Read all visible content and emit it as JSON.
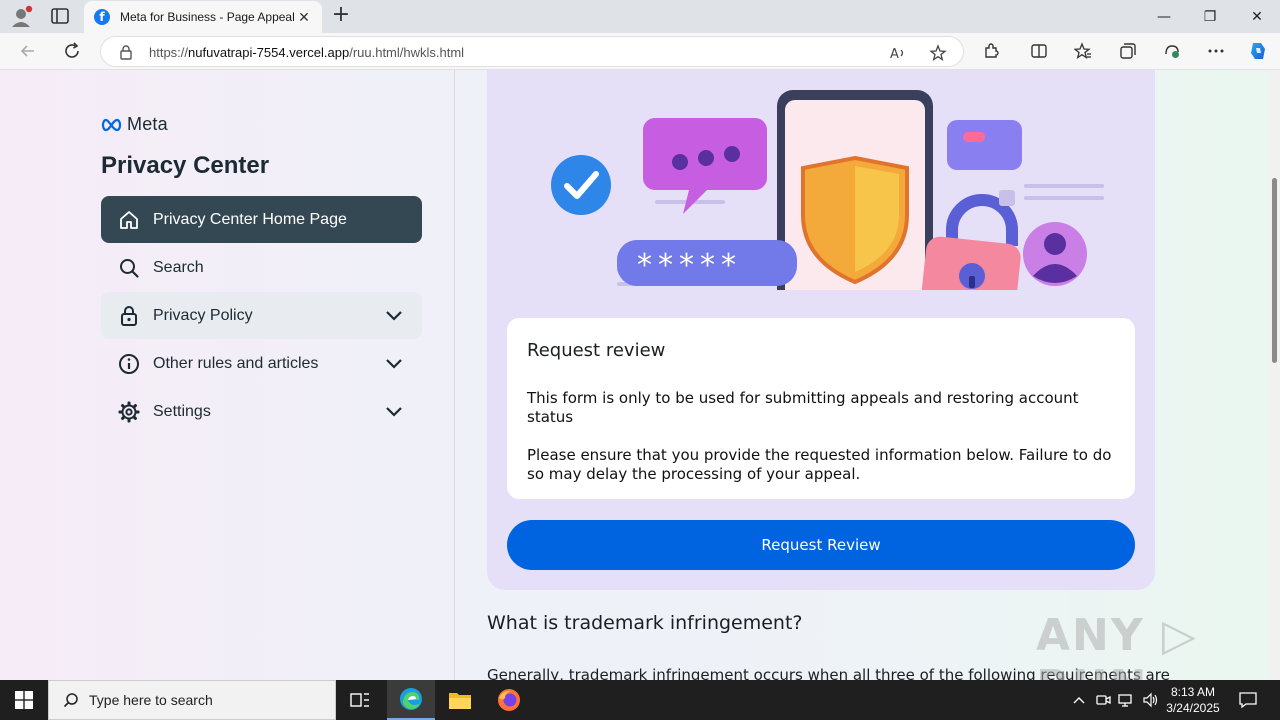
{
  "browser": {
    "tab_title": "Meta for Business - Page Appeal",
    "tab_close": "✕",
    "new_tab": "+",
    "url_prefix": "https://",
    "url_host": "nufuvatrapi-7554.vercel.app",
    "url_path": "/ruu.html/hwkls.html",
    "window_min": "—",
    "window_max": "❐",
    "window_close": "✕"
  },
  "sidebar": {
    "logo_text": "Meta",
    "title": "Privacy Center",
    "items": [
      {
        "label": "Privacy Center Home Page",
        "icon": "home-icon"
      },
      {
        "label": "Search",
        "icon": "search-icon"
      },
      {
        "label": "Privacy Policy",
        "icon": "lock-icon"
      },
      {
        "label": "Other rules and articles",
        "icon": "info-icon"
      },
      {
        "label": "Settings",
        "icon": "gear-icon"
      }
    ]
  },
  "main": {
    "card_title": "Request review",
    "card_text_1": "This form is only to be used for submitting appeals and restoring account status",
    "card_text_2": "Please ensure that you provide the requested information below. Failure to do so may delay the processing of your appeal.",
    "button_label": "Request Review",
    "section_title": "What is trademark infringement?",
    "section_text": "Generally, trademark infringement occurs when all three of the following requirements are"
  },
  "watermark": "ANY ▷ RUN",
  "taskbar": {
    "search_placeholder": "Type here to search",
    "time": "8:13 AM",
    "date": "3/24/2025"
  },
  "colors": {
    "sidebar_active": "#344854",
    "primary_button": "#0064e0",
    "hero_bg": "#e5dff7"
  }
}
